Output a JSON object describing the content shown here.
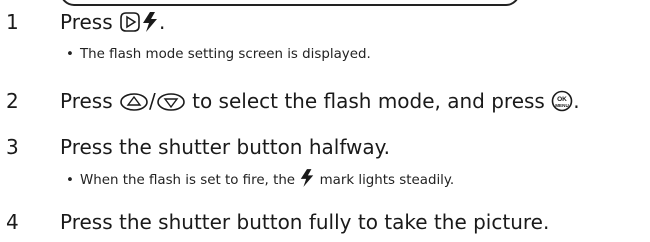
{
  "steps": [
    {
      "num": "1",
      "text_before": "Press",
      "text_after": ".",
      "icons": [
        "right-button-icon",
        "flash-icon"
      ],
      "note": "The flash mode setting screen is displayed."
    },
    {
      "num": "2",
      "text_before": "Press",
      "text_mid": "/",
      "text_mid2": "to select the flash mode, and press",
      "text_after": ".",
      "icons": [
        "up-button-icon",
        "down-button-icon",
        "ok-menu-button-icon"
      ]
    },
    {
      "num": "3",
      "text": "Press the shutter button halfway.",
      "note_before": "When the flash is set to fire, the",
      "note_after": "mark lights steadily.",
      "icons": [
        "flash-icon"
      ]
    },
    {
      "num": "4",
      "text": "Press the shutter button fully to take the picture."
    }
  ],
  "icons": {
    "ok_top": "OK",
    "ok_bottom": "MENU"
  },
  "colors": {
    "text": "#1a1a1a",
    "rule": "#222222"
  }
}
